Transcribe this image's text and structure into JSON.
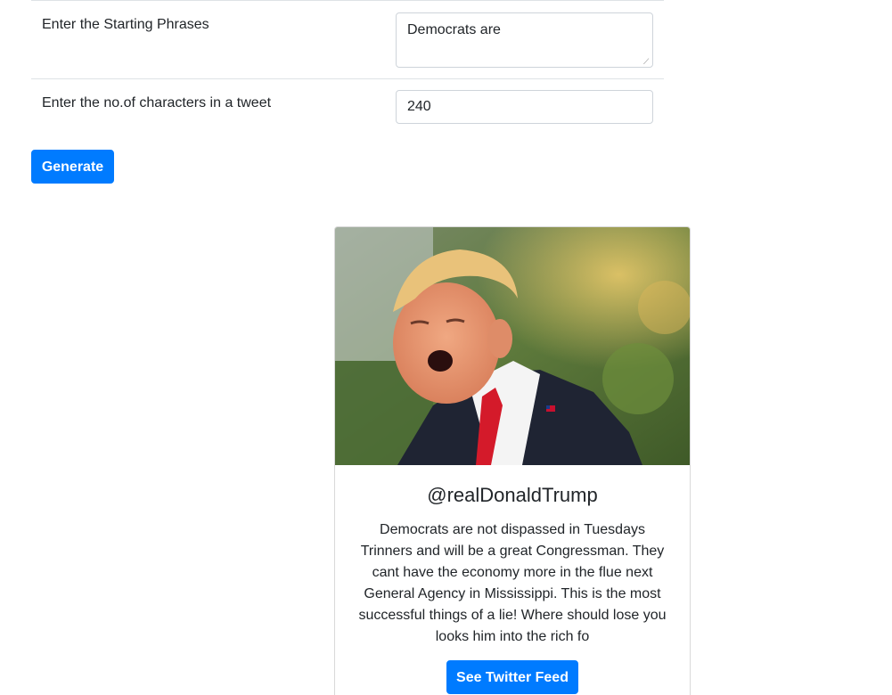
{
  "form": {
    "phrases_label": "Enter the Starting Phrases",
    "phrases_value": "Democrats are",
    "chars_label": "Enter the no.of characters in a tweet",
    "chars_value": "240",
    "generate_label": "Generate"
  },
  "card": {
    "image_icon": "portrait-photo",
    "title": "@realDonaldTrump",
    "text": "Democrats are not dispassed in Tuesdays Trinners and will be a great Congressman. They cant have the economy more in the flue next General Agency in Mississippi. This is the most successful things of a lie! Where should lose you looks him into the rich fo",
    "button_label": "See Twitter Feed"
  },
  "colors": {
    "primary": "#007bff",
    "border": "#dee2e6",
    "text": "#212529"
  }
}
